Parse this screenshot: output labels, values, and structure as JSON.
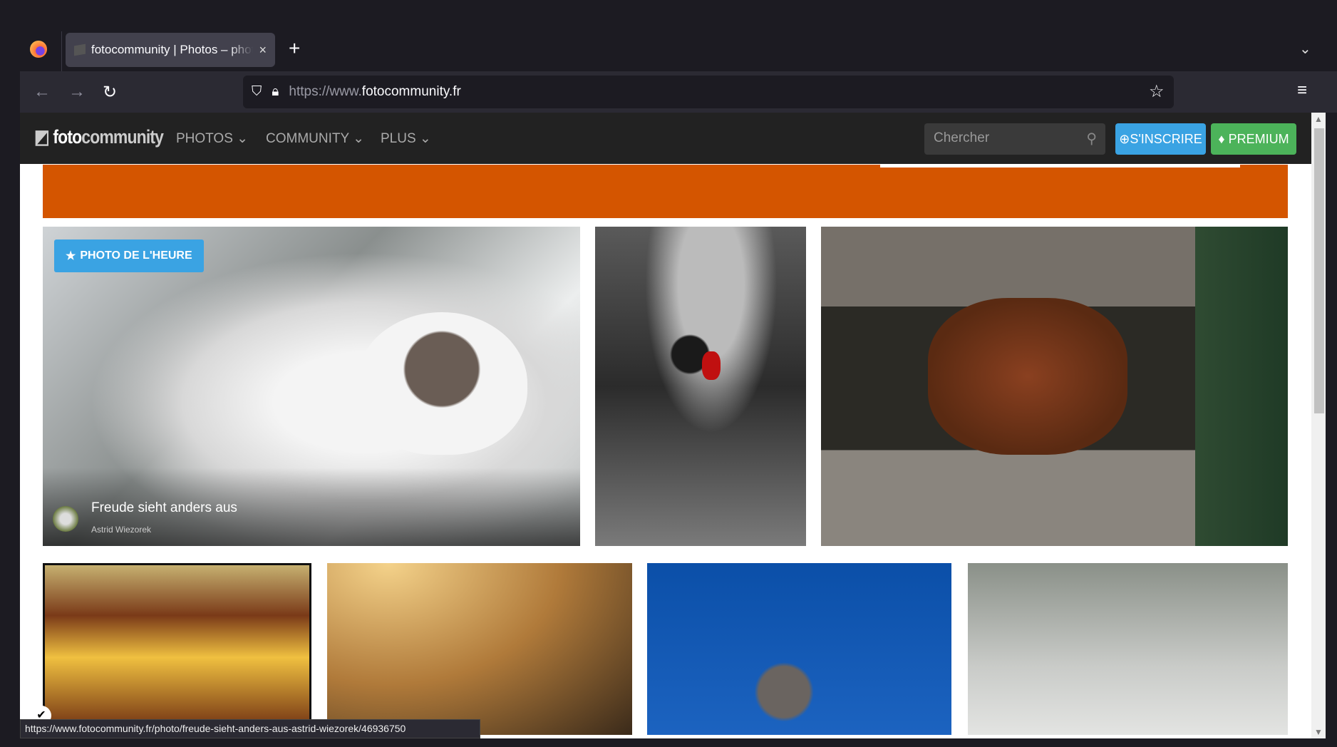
{
  "browser": {
    "tab_title": "fotocommunity | Photos – photo",
    "tab_close": "×",
    "new_tab": "+",
    "tab_list": "⌄",
    "url_prefix": "https://www.",
    "url_domain": "fotocommunity.fr",
    "back": "←",
    "forward": "→",
    "reload": "↻",
    "bookmark": "☆",
    "menu": "≡",
    "status_url": "https://www.fotocommunity.fr/photo/freude-sieht-anders-aus-astrid-wiezorek/46936750"
  },
  "site": {
    "logo_bold": "foto",
    "logo_rest": "community",
    "nav": [
      {
        "label": "PHOTOS ⌄"
      },
      {
        "label": "COMMUNITY ⌄"
      },
      {
        "label": "PLUS ⌄"
      }
    ],
    "search_placeholder": "Chercher",
    "signup_label": "S'INSCRIRE",
    "premium_label": "PREMIUM",
    "banner_color": "#d45500",
    "accent_blue": "#3aa3e3",
    "accent_green": "#4cb35a"
  },
  "featured": {
    "badge": "PHOTO DE L'HEURE",
    "title": "Freude sieht anders aus",
    "author": "Astrid Wiezorek"
  }
}
